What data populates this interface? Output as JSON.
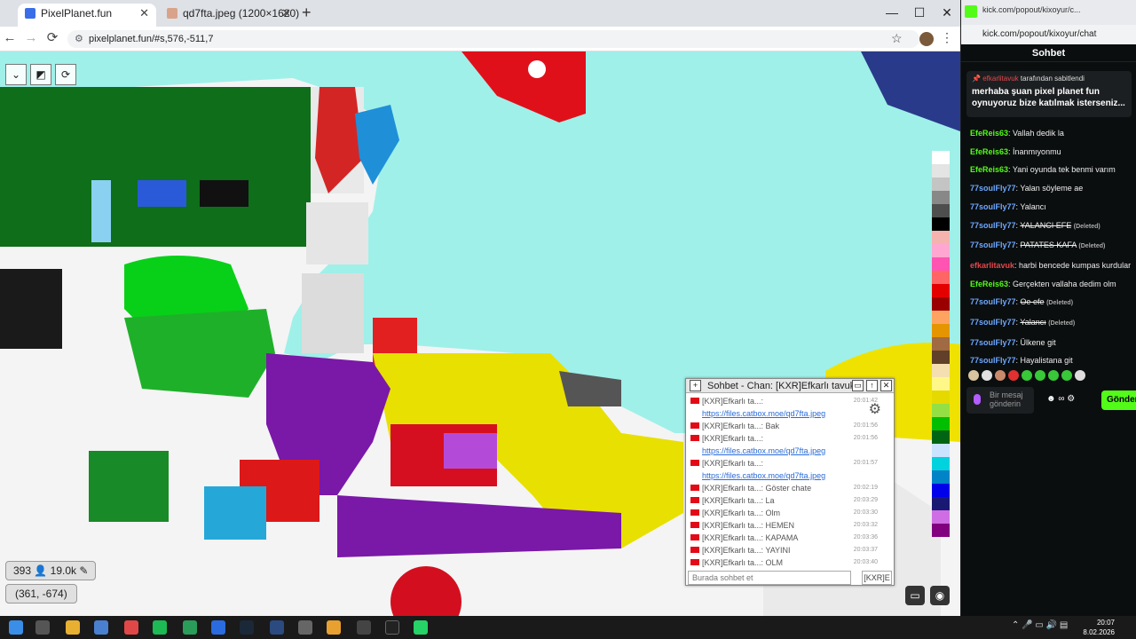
{
  "browser": {
    "tabs": [
      {
        "label": "PixelPlanet.fun",
        "active": true
      },
      {
        "label": "qd7fta.jpeg (1200×1620)",
        "active": false
      }
    ],
    "new_tab": "+",
    "window_controls": {
      "minimize": "—",
      "maximize": "☐",
      "close": "✕"
    },
    "nav": {
      "back": "←",
      "forward": "→",
      "reload": "⟳"
    },
    "url": "pixelplanet.fun/#s,576,-511,7",
    "star": "☆",
    "menu": "⋮"
  },
  "pixelplanet": {
    "toolbar": [
      "⌄",
      "◩",
      "⟳"
    ],
    "stats": {
      "online": "393",
      "total": "19.0k"
    },
    "coords": "(361, -674)",
    "palette": [
      "#ffffff",
      "#e4e4e4",
      "#c4c4c4",
      "#888888",
      "#4e4e4e",
      "#000000",
      "#f4b3ae",
      "#ffa7d1",
      "#ff54b2",
      "#ff6565",
      "#e50000",
      "#9a0000",
      "#fea460",
      "#e59500",
      "#a06a42",
      "#604028",
      "#f5dfb0",
      "#fff889",
      "#e5d900",
      "#94e044",
      "#02be01",
      "#006513",
      "#cae3ff",
      "#00d3dd",
      "#0083c7",
      "#0000ea",
      "#191973",
      "#cf6ee4",
      "#820080"
    ],
    "chat": {
      "title": "Sohbet - Chan: [KXR]Efkarlı tavuk",
      "messages": [
        {
          "user": "[KXR]Efkarlı ta...:",
          "text": "https://files.catbox.moe/qd7fta.jpeg",
          "time": "20:01:42",
          "link": true
        },
        {
          "user": "[KXR]Efkarlı ta...:",
          "text": "Bak",
          "time": "20:01:56",
          "link": false
        },
        {
          "user": "[KXR]Efkarlı ta...:",
          "text": "https://files.catbox.moe/qd7fta.jpeg",
          "time": "20:01:56",
          "link": true
        },
        {
          "user": "[KXR]Efkarlı ta...:",
          "text": "https://files.catbox.moe/qd7fta.jpeg",
          "time": "20:01:57",
          "link": true
        },
        {
          "user": "[KXR]Efkarlı ta...:",
          "text": "Göster chate",
          "time": "20:02:19",
          "link": false
        },
        {
          "user": "[KXR]Efkarlı ta...:",
          "text": "La",
          "time": "20:03:29",
          "link": false
        },
        {
          "user": "[KXR]Efkarlı ta...:",
          "text": "Olm",
          "time": "20:03:30",
          "link": false
        },
        {
          "user": "[KXR]Efkarlı ta...:",
          "text": "HEMEN",
          "time": "20:03:32",
          "link": false
        },
        {
          "user": "[KXR]Efkarlı ta...:",
          "text": "KAPAMA",
          "time": "20:03:36",
          "link": false
        },
        {
          "user": "[KXR]Efkarlı ta...:",
          "text": "YAYINI",
          "time": "20:03:37",
          "link": false
        },
        {
          "user": "[KXR]Efkarlı ta...:",
          "text": "OLM",
          "time": "20:03:40",
          "link": false
        }
      ],
      "input_placeholder": "Burada sohbet et",
      "channel_button": "[KXR]E"
    }
  },
  "kick": {
    "tab_label": "kick.com/popout/kixoyur/c...",
    "url": "kick.com/popout/kixoyur/chat",
    "title": "Sohbet",
    "pinned": {
      "by_user": "efkarlitavuk",
      "by_text": "tarafından sabitlendi",
      "message": "merhaba şuan pixel planet fun oynuyoruz bize katılmak isterseniz..."
    },
    "messages": [
      {
        "user": "EfeReis63",
        "color": "#53fc18",
        "text": "Vallah dedik la",
        "deleted": false
      },
      {
        "user": "EfeReis63",
        "color": "#53fc18",
        "text": "İnanmıyonmu",
        "deleted": false
      },
      {
        "user": "EfeReis63",
        "color": "#53fc18",
        "text": "Yani oyunda tek benmi varım",
        "deleted": false
      },
      {
        "user": "77soulFly77",
        "color": "#6ea8ff",
        "text": "Yalan söyleme ae",
        "deleted": false
      },
      {
        "user": "77soulFly77",
        "color": "#6ea8ff",
        "text": "Yalancı",
        "deleted": false
      },
      {
        "user": "77soulFly77",
        "color": "#6ea8ff",
        "text": "YALANCI EFE",
        "deleted": true
      },
      {
        "user": "77soulFly77",
        "color": "#6ea8ff",
        "text": "PATATES KAFA",
        "deleted": true
      },
      {
        "user": "efkarlitavuk",
        "color": "#e0474c",
        "text": "harbi bencede kumpas kurdular",
        "deleted": false
      },
      {
        "user": "EfeReis63",
        "color": "#53fc18",
        "text": "Gerçekten vallaha dedim olm",
        "deleted": false
      },
      {
        "user": "77soulFly77",
        "color": "#6ea8ff",
        "text": "Oe efe",
        "deleted": true
      },
      {
        "user": "77soulFly77",
        "color": "#6ea8ff",
        "text": "Yalancı",
        "deleted": true
      },
      {
        "user": "77soulFly77",
        "color": "#6ea8ff",
        "text": "Ülkene git",
        "deleted": false
      },
      {
        "user": "77soulFly77",
        "color": "#6ea8ff",
        "text": "Hayalistana git",
        "deleted": false
      }
    ],
    "deleted_label": "(Deleted)",
    "input_placeholder": "Bir mesaj gönderin",
    "send_label": "Gönder"
  },
  "taskbar": {
    "time": "20:07",
    "date": "8.02.2026"
  }
}
